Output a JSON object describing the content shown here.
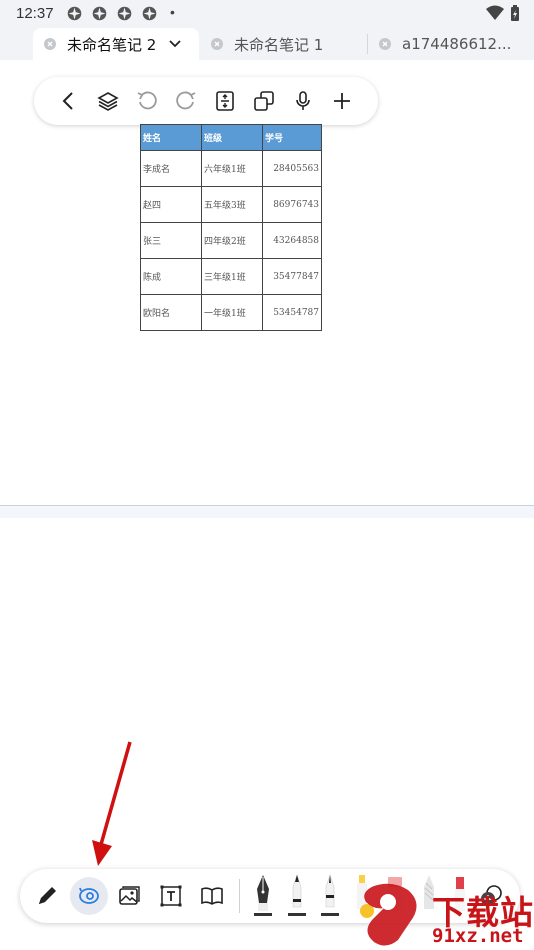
{
  "status": {
    "time": "12:37",
    "dot": "•"
  },
  "tabs": [
    {
      "label": "未命名笔记 2",
      "active": true
    },
    {
      "label": "未命名笔记 1",
      "active": false
    },
    {
      "label": "a174486612...",
      "active": false
    }
  ],
  "top_toolbar": {
    "items": [
      "back-icon",
      "layers-icon",
      "undo-icon",
      "redo-icon",
      "page-size-icon",
      "copy-icon",
      "microphone-icon",
      "add-icon"
    ]
  },
  "table": {
    "headers": [
      "姓名",
      "班级",
      "学号"
    ],
    "rows": [
      [
        "李成名",
        "六年级1班",
        "28405563"
      ],
      [
        "赵四",
        "五年级3班",
        "86976743"
      ],
      [
        "张三",
        "四年级2班",
        "43264858"
      ],
      [
        "陈成",
        "三年级1班",
        "35477847"
      ],
      [
        "欧阳名",
        "一年级1班",
        "53454787"
      ]
    ]
  },
  "bottom_toolbar": {
    "tools": [
      "pen-icon",
      "lasso-icon",
      "image-icon",
      "text-box-icon",
      "book-icon"
    ],
    "pens": [
      "fountain-pen",
      "ballpoint-pen",
      "fineliner-pen",
      "highlighter-yellow",
      "highlighter-pink",
      "pencil",
      "red-marker"
    ],
    "selected_tool": "lasso-icon"
  },
  "colors": {
    "accent": "#5b9bd5",
    "annotation_arrow": "#d01010",
    "watermark": "#c81418"
  },
  "watermark": {
    "text_top": "下载站",
    "text_bottom": "91xz.net"
  }
}
